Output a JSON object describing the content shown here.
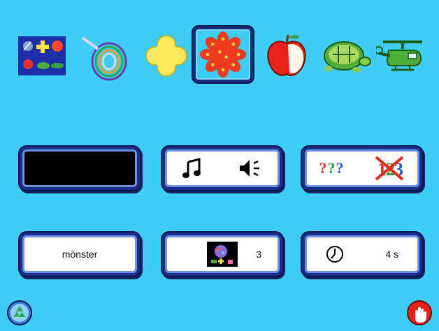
{
  "toolbar": {
    "items": [
      {
        "name": "all-themes",
        "selected": false
      },
      {
        "name": "spiral",
        "selected": false
      },
      {
        "name": "yellow-cross",
        "selected": false
      },
      {
        "name": "red-flower",
        "selected": true
      },
      {
        "name": "apple",
        "selected": false
      },
      {
        "name": "turtle",
        "selected": false
      },
      {
        "name": "helicopter",
        "selected": false
      }
    ]
  },
  "settings": {
    "color_button": {
      "color": "#000000"
    },
    "sound_button": {
      "icons": [
        "music-note-icon",
        "speaker-icon"
      ]
    },
    "hint_button": {
      "question_marks": "???",
      "question_mark_colors": [
        "#e8312a",
        "#2a9c3a",
        "#2a5ad8"
      ]
    },
    "category_button": {
      "label": "mönster"
    },
    "count_button": {
      "value": "3"
    },
    "time_button": {
      "value": "4 s"
    }
  },
  "colors": {
    "background": "#3dcdf5",
    "button_border": "#1a2f8c"
  }
}
